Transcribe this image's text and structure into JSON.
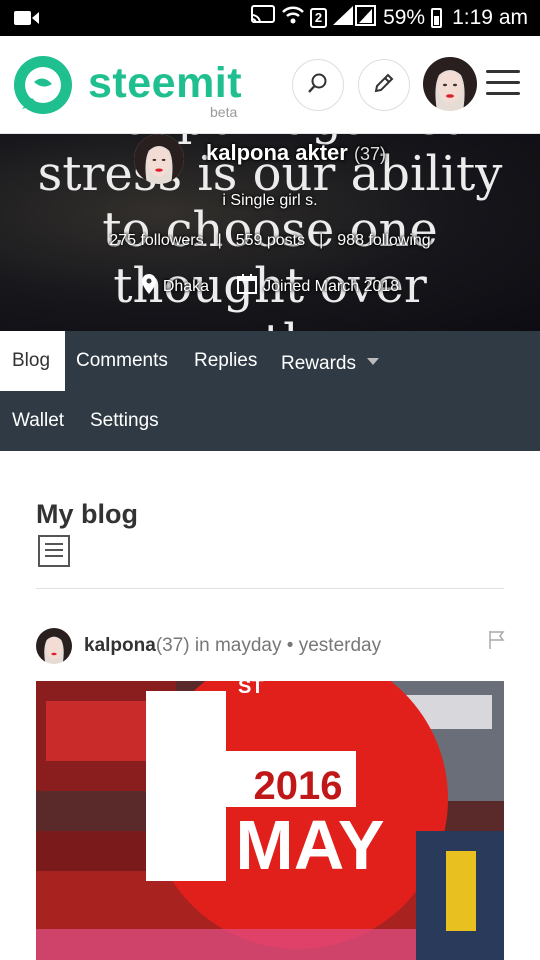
{
  "status_bar": {
    "battery": "59%",
    "time": "1:19 am",
    "sim_slot": "2"
  },
  "header": {
    "brand": "steemit",
    "beta": "beta",
    "brand_color": "#1fbf8f"
  },
  "banner": {
    "quote_lines": [
      "weapon against",
      "stress is our ability",
      "to choose one",
      "thought over",
      "another"
    ],
    "name": "kalpona akter",
    "reputation": "(37)",
    "about": "i Single girl s.",
    "followers": "275 followers",
    "posts": "559 posts",
    "following": "988 following",
    "location": "Dhaka",
    "joined": "Joined March 2018"
  },
  "tabs": {
    "blog": "Blog",
    "comments": "Comments",
    "replies": "Replies",
    "rewards": "Rewards",
    "wallet": "Wallet",
    "settings": "Settings"
  },
  "content": {
    "title": "My blog",
    "post": {
      "author": "kalpona",
      "reputation": "(37)",
      "in_label": "in",
      "category": "mayday",
      "bullet": "•",
      "time": "yesterday",
      "image_text_top": "ST",
      "image_year": "2016",
      "image_month": "MAY",
      "image_number": "1"
    }
  }
}
